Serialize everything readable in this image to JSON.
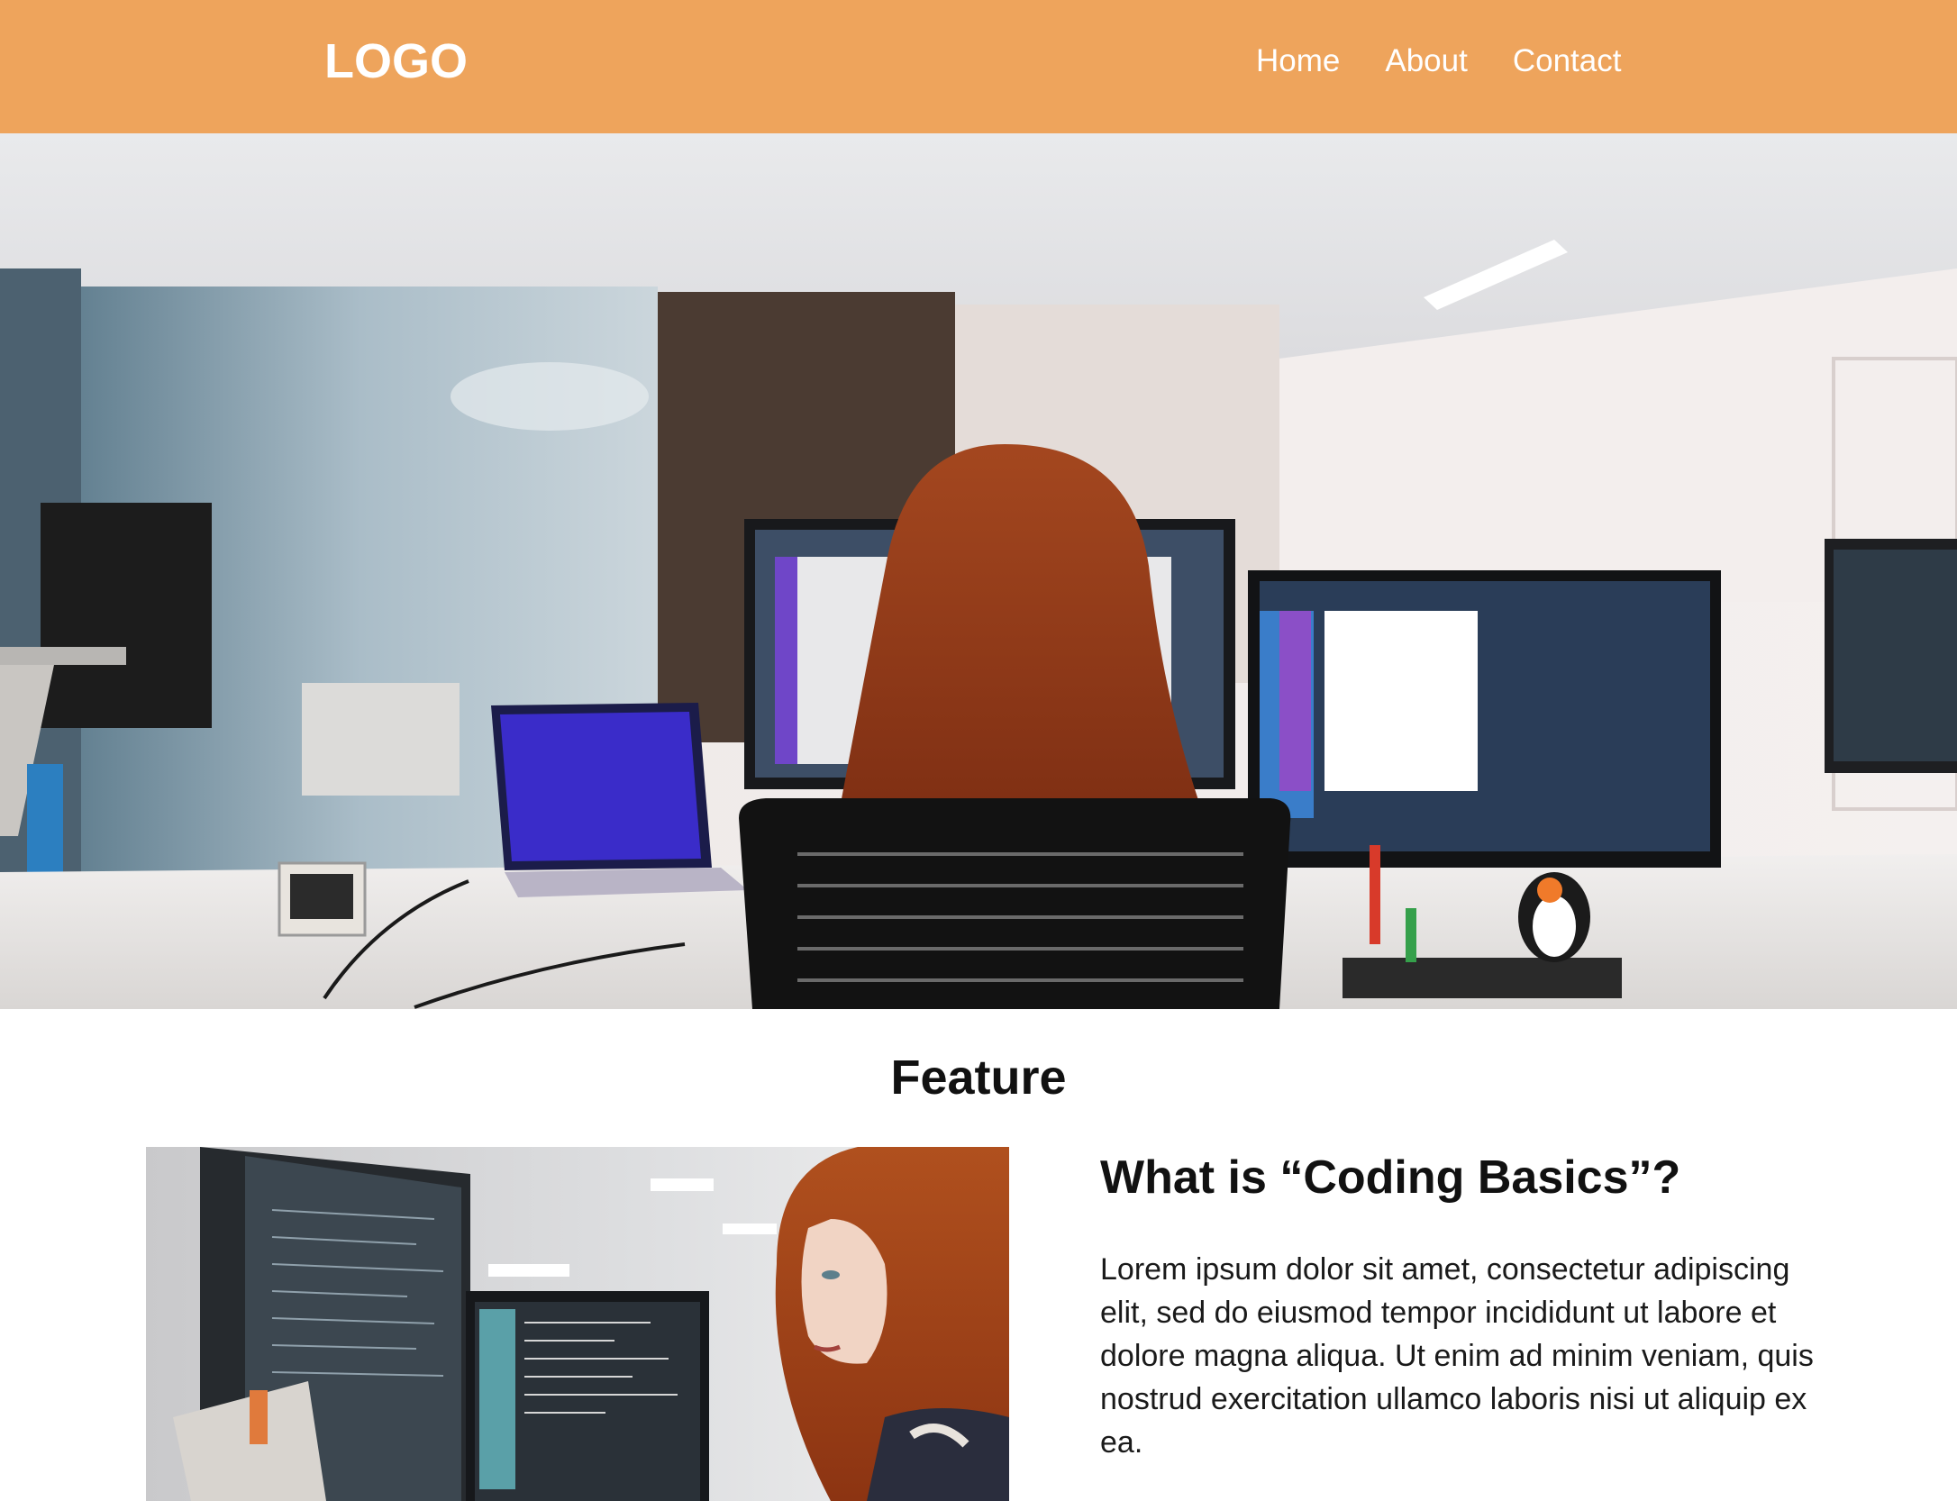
{
  "header": {
    "logo": "LOGO",
    "nav": [
      {
        "label": "Home"
      },
      {
        "label": "About"
      },
      {
        "label": "Contact"
      }
    ]
  },
  "colors": {
    "header_bg": "#eea45c",
    "text_dark": "#111111"
  },
  "feature": {
    "section_title": "Feature",
    "heading": "What is “Coding Basics”?",
    "body": "Lorem ipsum dolor sit amet, consectetur adipiscing elit, sed do eiusmod tempor incididunt ut labore et dolore magna aliqua. Ut enim ad minim veniam, quis nostrud exercitation ullamco laboris nisi ut aliquip ex ea."
  }
}
